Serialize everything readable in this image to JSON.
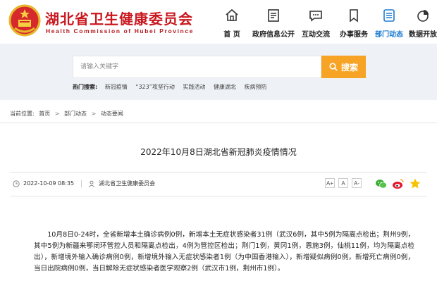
{
  "header": {
    "title": "湖北省卫生健康委员会",
    "subtitle": "Health Commission of Hubei Province",
    "brand_color": "#c9171e"
  },
  "nav": [
    {
      "label": "首 页",
      "icon": "home-icon"
    },
    {
      "label": "政府信息公开",
      "icon": "document-list-icon"
    },
    {
      "label": "互动交流",
      "icon": "chat-icon"
    },
    {
      "label": "办事服务",
      "icon": "bookmark-icon"
    },
    {
      "label": "部门动态",
      "icon": "news-icon",
      "active": true
    },
    {
      "label": "数据开放",
      "icon": "pie-chart-icon"
    }
  ],
  "search": {
    "placeholder": "请输入关键字",
    "button_label": "搜索",
    "button_color": "#f7a325"
  },
  "hot": {
    "label": "热门搜索:",
    "links": [
      "新冠疫情",
      "“323”攻坚行动",
      "实践活动",
      "健康湖北",
      "疾病预防"
    ]
  },
  "breadcrumb": {
    "label": "当前位置:",
    "items": [
      "首页",
      "部门动态",
      "动态要闻"
    ]
  },
  "article": {
    "title": "2022年10月8日湖北省新冠肺炎疫情情况",
    "date": "2022-10-09 08:35",
    "source": "湖北省卫生健康委员会",
    "font_buttons": [
      "A+",
      "A",
      "A-"
    ],
    "body": "10月8日0-24时，全省新增本土确诊病例0例，新增本土无症状感染者31例（武汉6例，其中5例为隔离点检出；荆州9例，其中5例为新疆来鄂闭环管控人员和隔离点检出，4例为管控区检出；荆门1例，黄冈1例，恩施3例，仙桃11例，均为隔离点检出），新增境外输入确诊病例0例，新增境外输入无症状感染者1例（为中国香港输入），新增疑似病例0例，新增死亡病例0例，当日出院病例0例，当日解除无症状感染者医学观察2例（武汉市1例，荆州市1例）。"
  },
  "share_icons": [
    "wechat-icon",
    "weibo-icon",
    "favorite-star-icon"
  ]
}
